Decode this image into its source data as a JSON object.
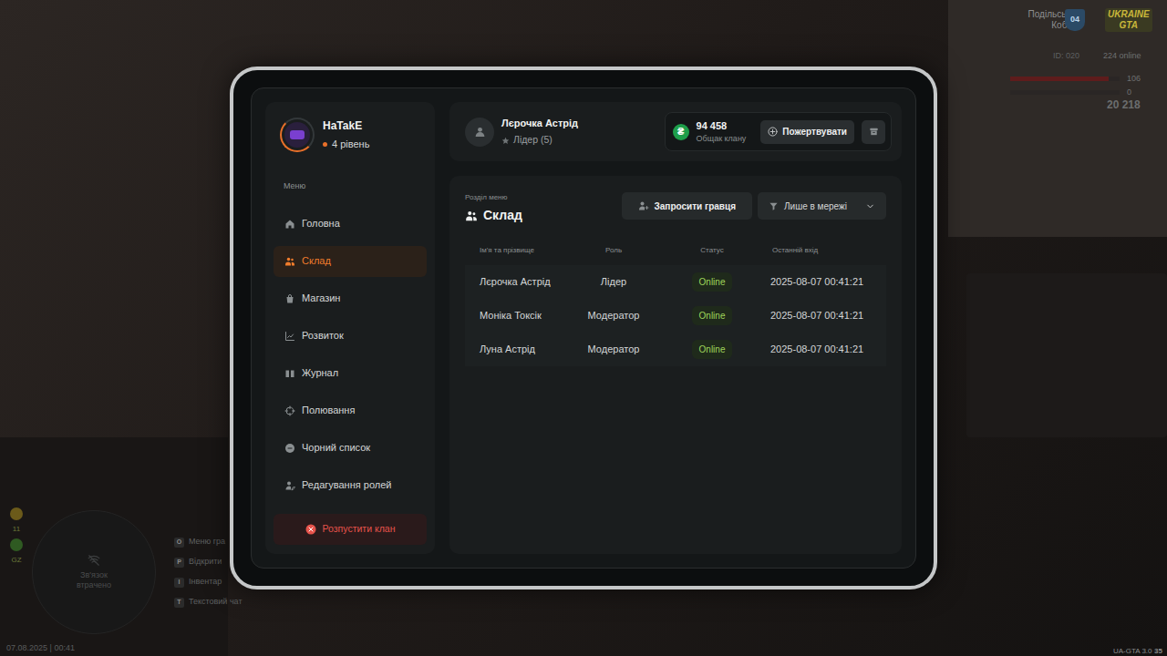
{
  "hud": {
    "region": [
      "Подільські",
      "Коби"
    ],
    "region_badge": "04",
    "logo": [
      "UKRAINE",
      "GTA"
    ],
    "player_id": "ID: 020",
    "online": "224 online",
    "health": {
      "reading": "106",
      "level": 0.9
    },
    "armor": {
      "reading": "0",
      "level": 0
    },
    "money": "20 218",
    "side_stats": [
      "11",
      "GZ"
    ],
    "minimap_text": "Зв'язок втрачено",
    "datetime": "07.08.2025 | 00:41",
    "keybinds": [
      {
        "key": "O",
        "label": "Меню гра"
      },
      {
        "key": "P",
        "label": "Відкрити"
      },
      {
        "key": "I",
        "label": "Інвентар"
      },
      {
        "key": "T",
        "label": "Текстовий чат"
      }
    ],
    "version": "UA-GTA 3.0",
    "fps": "35"
  },
  "profile": {
    "name": "HaTakE",
    "level": "4 рівень"
  },
  "menu": {
    "caption": "Меню",
    "items": [
      {
        "label": "Головна",
        "selected": false
      },
      {
        "label": "Склад",
        "selected": true
      },
      {
        "label": "Магазин",
        "selected": false
      },
      {
        "label": "Розвиток",
        "selected": false
      },
      {
        "label": "Журнал",
        "selected": false
      },
      {
        "label": "Полювання",
        "selected": false
      },
      {
        "label": "Чорний список",
        "selected": false
      },
      {
        "label": "Редагування ролей",
        "selected": false
      }
    ]
  },
  "dissolve_button": "Розпустити клан",
  "header": {
    "name": "Лєрочка Астрід",
    "role": "Лідер (5)",
    "balance_icon": "₴",
    "balance": "94 458",
    "balance_caption": "Общак клану",
    "donate_button": "Пожертвувати"
  },
  "section": {
    "caption": "Розділ меню",
    "title": "Склад",
    "invite_button": "Запросити гравця",
    "filter": "Лише в мережі"
  },
  "table": {
    "columns": [
      "Ім'я та прізвище",
      "Роль",
      "Статус",
      "Останній вхід"
    ],
    "rows": [
      [
        "Лєрочка Астрід",
        "Лідер",
        "Online",
        "2025-08-07 00:41:21"
      ],
      [
        "Моніка Токсік",
        "Модератор",
        "Online",
        "2025-08-07 00:41:21"
      ],
      [
        "Луна Астрід",
        "Модератор",
        "Online",
        "2025-08-07 00:41:21"
      ]
    ]
  }
}
